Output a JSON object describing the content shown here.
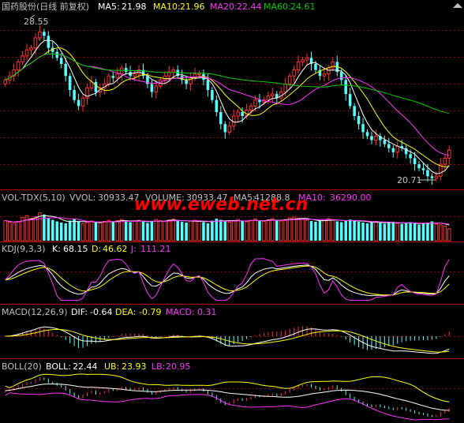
{
  "colors": {
    "bg": "#000000",
    "up": "#ff3232",
    "down": "#54ffff",
    "grid": "#8b0000",
    "sep": "#b40000",
    "text": "#c0c0c0",
    "white": "#ffffff",
    "yellow": "#ffff00",
    "magenta": "#ff33ff",
    "green": "#00cc00",
    "watermark": "#ff0000"
  },
  "watermark": "www.eweb.net.cn",
  "chart_data": [
    {
      "type": "candlestick",
      "panel": "price",
      "title": "国药股份(日线 前复权)",
      "indicators": [
        {
          "label": "MA5:",
          "value": "21.98",
          "color": "#ffffff"
        },
        {
          "label": "MA10:",
          "value": "21.96",
          "color": "#ffff00"
        },
        {
          "label": "MA20:",
          "value": "22.44",
          "color": "#ff33ff"
        },
        {
          "label": "MA60:",
          "value": "24.61",
          "color": "#00cc00"
        }
      ],
      "annotations": [
        {
          "text": "28.55",
          "kind": "high"
        },
        {
          "text": "20.71",
          "kind": "low"
        }
      ],
      "ylim": [
        20.5,
        29.0
      ],
      "candles_open": [
        25.6,
        25.8,
        26.0,
        26.3,
        26.7,
        27.0,
        27.3,
        27.4,
        27.9,
        28.2,
        28.0,
        27.4,
        27.2,
        26.9,
        26.6,
        26.0,
        25.3,
        24.8,
        24.5,
        24.9,
        25.4,
        25.7,
        25.2,
        25.4,
        25.6,
        26.0,
        25.9,
        26.1,
        26.4,
        26.2,
        26.0,
        26.1,
        26.3,
        26.0,
        25.6,
        25.2,
        25.5,
        25.8,
        26.0,
        26.2,
        26.3,
        26.0,
        25.8,
        25.6,
        25.9,
        26.1,
        26.1,
        25.8,
        25.3,
        24.8,
        24.2,
        23.6,
        23.2,
        23.5,
        24.0,
        24.2,
        24.0,
        24.3,
        24.5,
        24.8,
        24.7,
        24.8,
        25.0,
        25.1,
        24.9,
        25.2,
        25.6,
        26.0,
        26.3,
        26.7,
        26.8,
        26.9,
        26.6,
        26.3,
        26.0,
        26.1,
        26.4,
        26.7,
        26.2,
        25.8,
        25.1,
        24.5,
        24.0,
        23.6,
        23.2,
        23.0,
        22.8,
        23.0,
        22.8,
        22.6,
        22.4,
        22.2,
        22.5,
        22.4,
        22.1,
        21.9,
        21.6,
        21.4,
        21.3,
        21.0,
        20.9,
        21.0,
        21.6,
        21.9
      ],
      "candles_close": [
        25.8,
        26.0,
        26.3,
        26.7,
        27.0,
        27.3,
        27.4,
        27.9,
        28.2,
        28.0,
        27.4,
        27.2,
        26.9,
        26.6,
        26.0,
        25.3,
        24.8,
        24.5,
        24.9,
        25.4,
        25.7,
        25.2,
        25.4,
        25.6,
        26.0,
        25.9,
        26.1,
        26.4,
        26.2,
        26.0,
        26.1,
        26.3,
        26.0,
        25.6,
        25.2,
        25.5,
        25.8,
        26.0,
        26.2,
        26.3,
        26.0,
        25.8,
        25.6,
        25.9,
        26.1,
        26.1,
        25.8,
        25.3,
        24.8,
        24.2,
        23.6,
        23.2,
        23.5,
        24.0,
        24.2,
        24.0,
        24.3,
        24.5,
        24.8,
        24.7,
        24.8,
        25.0,
        25.1,
        24.9,
        25.2,
        25.6,
        26.0,
        26.3,
        26.7,
        26.8,
        26.9,
        26.6,
        26.3,
        26.0,
        26.1,
        26.4,
        26.7,
        26.2,
        25.8,
        25.1,
        24.5,
        24.0,
        23.6,
        23.2,
        23.0,
        22.8,
        23.0,
        22.8,
        22.6,
        22.4,
        22.2,
        22.5,
        22.4,
        22.1,
        21.9,
        21.6,
        21.4,
        21.3,
        21.0,
        20.9,
        21.0,
        21.6,
        21.9,
        22.3
      ]
    },
    {
      "type": "bar",
      "panel": "volume",
      "title": "VOL-TDX(5,10)",
      "indicators": [
        {
          "label": "VVOL:",
          "value": "30933.47",
          "color": "#c0c0c0"
        },
        {
          "label": "VOLUME:",
          "value": "30933.47",
          "color": "#c0c0c0"
        },
        {
          "label": "MA5:",
          "value": "41288.8",
          "color": "#c0c0c0"
        },
        {
          "label": "MA10:",
          "value": "36290.00",
          "color": "#ff33ff"
        }
      ],
      "values": [
        52000,
        48000,
        45000,
        50000,
        60000,
        65000,
        58000,
        62000,
        72000,
        68000,
        59000,
        54000,
        50000,
        47000,
        45000,
        52000,
        56000,
        49000,
        44000,
        47000,
        51000,
        48000,
        46000,
        50000,
        53000,
        49000,
        52000,
        55000,
        51000,
        48000,
        50000,
        53000,
        49000,
        46000,
        51000,
        55000,
        52000,
        50000,
        54000,
        56000,
        52000,
        49000,
        47000,
        51000,
        53000,
        50000,
        48000,
        45000,
        52000,
        57000,
        54000,
        50000,
        48000,
        52000,
        55000,
        51000,
        49000,
        53000,
        56000,
        52000,
        50000,
        54000,
        57000,
        53000,
        51000,
        55000,
        59000,
        61000,
        58000,
        56000,
        53000,
        51000,
        49000,
        52000,
        55000,
        57000,
        54000,
        50000,
        48000,
        52000,
        55000,
        51000,
        49000,
        47000,
        45000,
        48000,
        50000,
        46000,
        44000,
        47000,
        49000,
        45000,
        43000,
        46000,
        48000,
        44000,
        42000,
        45000,
        47000,
        50000,
        43000,
        41000,
        38000,
        30933
      ]
    },
    {
      "type": "line",
      "panel": "kdj",
      "title": "KDJ(9,3,3)",
      "indicators": [
        {
          "label": "K:",
          "value": "68.15",
          "color": "#ffffff"
        },
        {
          "label": "D:",
          "value": "46.62",
          "color": "#ffff00"
        },
        {
          "label": "J:",
          "value": "111.21",
          "color": "#ff33ff"
        }
      ],
      "ylim": [
        -10,
        115
      ]
    },
    {
      "type": "bar",
      "panel": "macd",
      "title": "MACD(12,26,9)",
      "indicators": [
        {
          "label": "DIF:",
          "value": "-0.64",
          "color": "#ffffff"
        },
        {
          "label": "DEA:",
          "value": "-0.79",
          "color": "#ffff00"
        },
        {
          "label": "MACD:",
          "value": "0.31",
          "color": "#ff33ff"
        }
      ]
    },
    {
      "type": "line",
      "panel": "boll",
      "title": "BOLL(20)",
      "indicators": [
        {
          "label": "BOLL:",
          "value": "22.44",
          "color": "#ffffff"
        },
        {
          "label": "UB:",
          "value": "23.93",
          "color": "#ffff00"
        },
        {
          "label": "LB:",
          "value": "20.95",
          "color": "#ff33ff"
        }
      ]
    }
  ]
}
